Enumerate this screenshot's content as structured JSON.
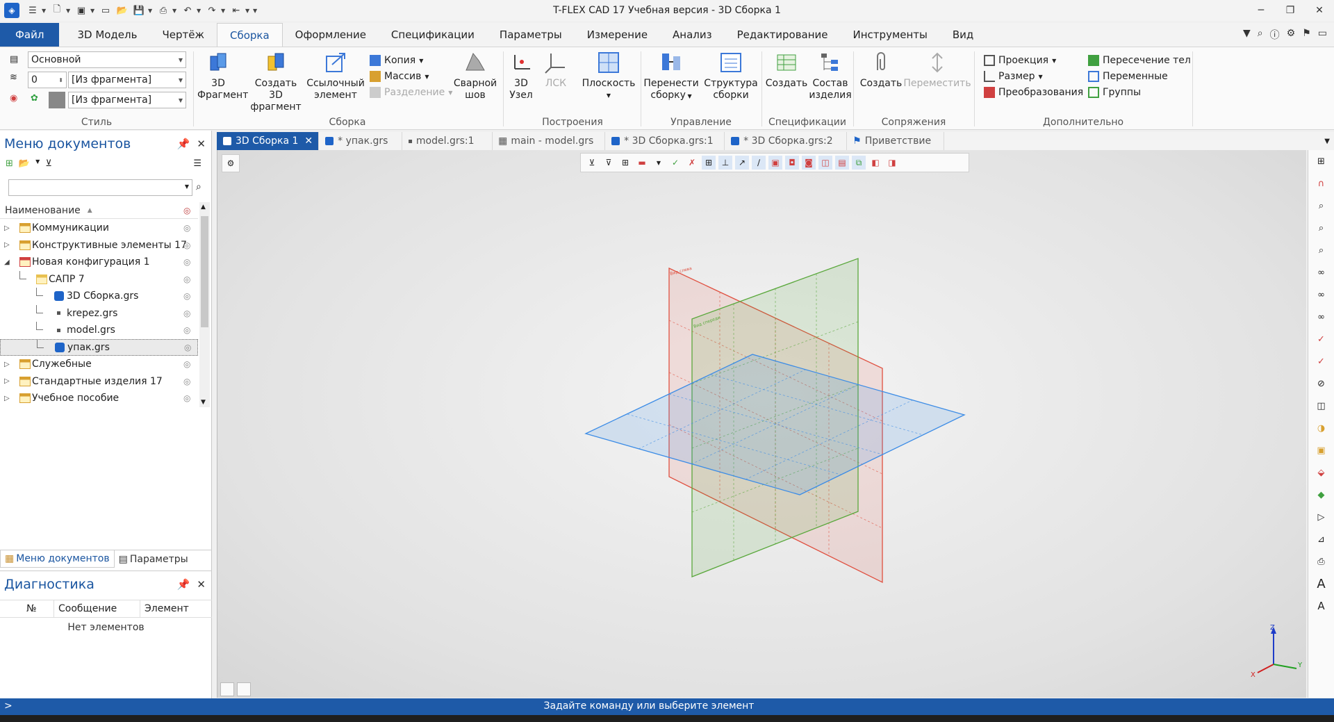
{
  "window": {
    "title": "T-FLEX CAD 17 Учебная версия - 3D Сборка 1",
    "controls": [
      "minimize-icon",
      "restore-icon",
      "close-icon"
    ]
  },
  "ribbon_tabs": [
    {
      "label": "Файл"
    },
    {
      "label": "3D Модель"
    },
    {
      "label": "Чертёж"
    },
    {
      "label": "Сборка",
      "active": true
    },
    {
      "label": "Оформление"
    },
    {
      "label": "Спецификации"
    },
    {
      "label": "Параметры"
    },
    {
      "label": "Измерение"
    },
    {
      "label": "Анализ"
    },
    {
      "label": "Редактирование"
    },
    {
      "label": "Инструменты"
    },
    {
      "label": "Вид"
    }
  ],
  "style_group": {
    "label": "Стиль",
    "layer_value": "Основной",
    "level_value": "0",
    "level_source": "[Из фрагмента]",
    "color_source": "[Из фрагмента]"
  },
  "assembly_group": {
    "label": "Сборка",
    "fragment_3d": "3D Фрагмент",
    "create_fragment_line1": "Создать 3D",
    "create_fragment_line2": "фрагмент",
    "ref_element_line1": "Ссылочный",
    "ref_element_line2": "элемент",
    "copy": "Копия",
    "array": "Массив",
    "split": "Разделение",
    "weld_line1": "Сварной",
    "weld_line2": "шов"
  },
  "construct_group": {
    "label": "Построения",
    "node_line1": "3D",
    "node_line2": "Узел",
    "lcs": "ЛСК",
    "plane": "Плоскость"
  },
  "manage_group": {
    "label": "Управление",
    "move_line1": "Перенести",
    "move_line2": "сборку",
    "structure_line1": "Структура",
    "structure_line2": "сборки"
  },
  "spec_group": {
    "label": "Спецификации",
    "create": "Создать",
    "compose_line1": "Состав",
    "compose_line2": "изделия"
  },
  "mates_group": {
    "label": "Сопряжения",
    "create": "Создать",
    "move": "Переместить"
  },
  "extra_group": {
    "label": "Дополнительно",
    "projection": "Проекция",
    "size": "Размер",
    "transforms": "Преобразования",
    "intersection": "Пересечение тел",
    "variables": "Переменные",
    "groups": "Группы"
  },
  "doc_menu": {
    "title": "Меню документов",
    "column_header": "Наименование",
    "tree": [
      {
        "label": "Коммуникации",
        "level": 0,
        "expander": "▷",
        "icon": "folder-lib-icon"
      },
      {
        "label": "Конструктивные элементы 17",
        "level": 0,
        "expander": "▷",
        "icon": "folder-lib-icon"
      },
      {
        "label": "Новая конфигурация 1",
        "level": 0,
        "expander": "◢",
        "icon": "config-icon"
      },
      {
        "label": "САПР 7",
        "level": 1,
        "expander": "",
        "icon": "folder-icon"
      },
      {
        "label": "3D Сборка.grs",
        "level": 2,
        "expander": "",
        "icon": "assembly-doc-icon"
      },
      {
        "label": "krepez.grs",
        "level": 2,
        "expander": "",
        "icon": "part-doc-icon"
      },
      {
        "label": "model.grs",
        "level": 2,
        "expander": "",
        "icon": "part-doc-icon"
      },
      {
        "label": "упак.grs",
        "level": 2,
        "expander": "",
        "icon": "assembly-doc-icon",
        "selected": true
      },
      {
        "label": "Служебные",
        "level": 0,
        "expander": "▷",
        "icon": "folder-lib-icon"
      },
      {
        "label": "Стандартные изделия 17",
        "level": 0,
        "expander": "▷",
        "icon": "folder-lib-icon"
      },
      {
        "label": "Учебное пособие",
        "level": 0,
        "expander": "▷",
        "icon": "folder-lib-icon"
      }
    ],
    "tab_docs": "Меню документов",
    "tab_params": "Параметры"
  },
  "diagnostics": {
    "title": "Диагностика",
    "col_num": "№",
    "col_message": "Сообщение",
    "col_element": "Элемент",
    "empty": "Нет элементов"
  },
  "doc_tabs": [
    {
      "label": "3D Сборка 1",
      "active": true,
      "closable": true
    },
    {
      "label": "* упак.grs"
    },
    {
      "label": "model.grs:1"
    },
    {
      "label": "main - model.grs"
    },
    {
      "label": "* 3D Сборка.grs:1"
    },
    {
      "label": "* 3D Сборка.grs:2"
    },
    {
      "label": "Приветствие"
    }
  ],
  "viewport": {
    "plane_labels": [
      "Вид слева",
      "Вид спереди"
    ],
    "triad_axes": [
      "Z",
      "X",
      "Y"
    ]
  },
  "status": {
    "prompt": ">",
    "message": "Задайте команду или выберите элемент"
  },
  "colors": {
    "accent": "#1e5aa8",
    "plane_side": "#e05040",
    "plane_front": "#5aa83c",
    "plane_top": "#3c8ce6"
  }
}
